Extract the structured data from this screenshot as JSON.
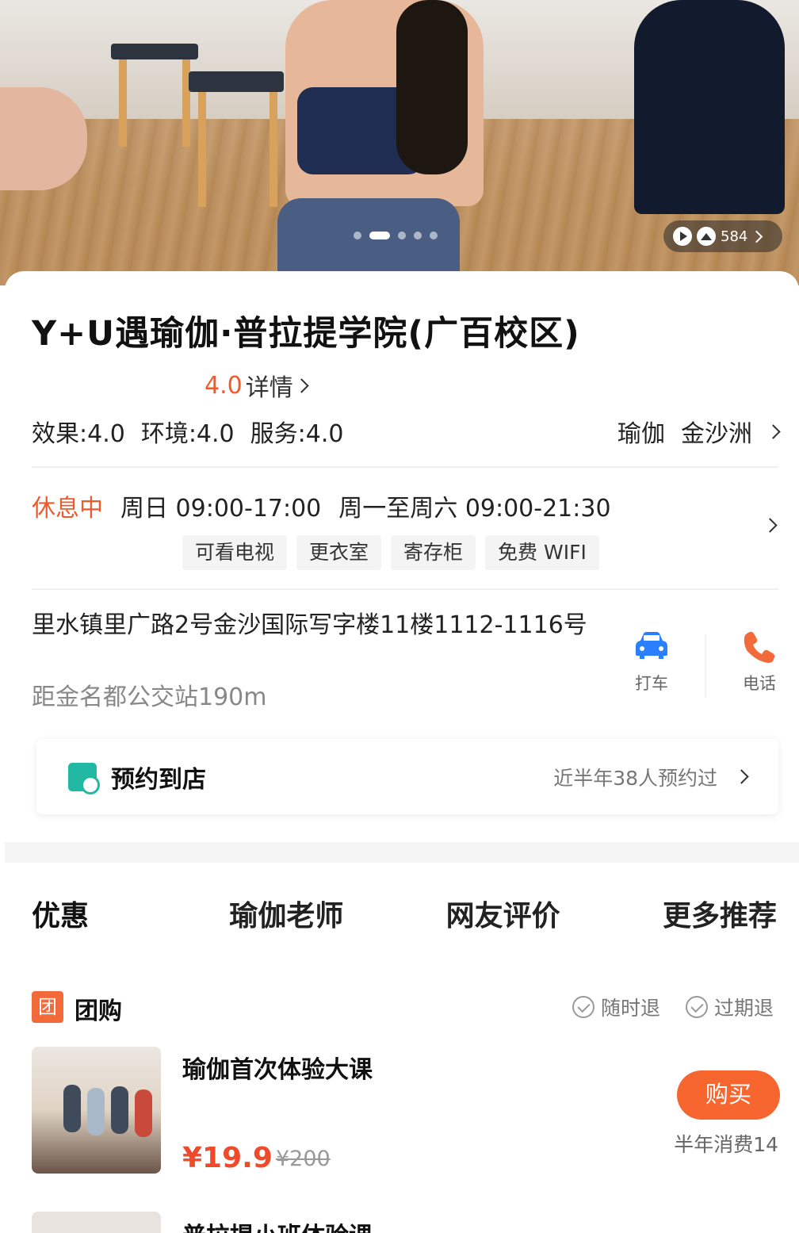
{
  "hero": {
    "media_count": "584"
  },
  "shop": {
    "name": "Y+U遇瑜伽·普拉提学院(广百校区)",
    "rating": "4.0",
    "rating_detail": "详情",
    "scores": [
      "效果:4.0",
      "环境:4.0",
      "服务:4.0"
    ],
    "category": "瑜伽",
    "area": "金沙洲"
  },
  "hours": {
    "status": "休息中",
    "sunday": "周日 09:00-17:00",
    "weekdays": "周一至周六 09:00-21:30"
  },
  "facilities": [
    "可看电视",
    "更衣室",
    "寄存柜",
    "免费 WIFI"
  ],
  "location": {
    "address": "里水镇里广路2号金沙国际写字楼11楼1112-1116号",
    "distance": "距金名都公交站190m",
    "taxi_label": "打车",
    "phone_label": "电话"
  },
  "booking": {
    "label": "预约到店",
    "count_text": "近半年38人预约过"
  },
  "tabs": [
    "优惠",
    "瑜伽老师",
    "网友评价",
    "更多推荐"
  ],
  "group_buy": {
    "badge": "团",
    "label": "团购",
    "policies": [
      "随时退",
      "过期退"
    ],
    "deals": [
      {
        "title": "瑜伽首次体验大课",
        "price": "¥19.9",
        "original_price": "¥200",
        "buy_label": "购买",
        "sold_text": "半年消费14"
      },
      {
        "title": "普拉提小班体验课"
      }
    ]
  },
  "colors": {
    "accent": "#ef5a2c",
    "buy_button": "#f6662e",
    "taxi_icon": "#2a7fff",
    "phone_icon": "#f26a3a",
    "calendar_icon": "#22b9a4"
  }
}
